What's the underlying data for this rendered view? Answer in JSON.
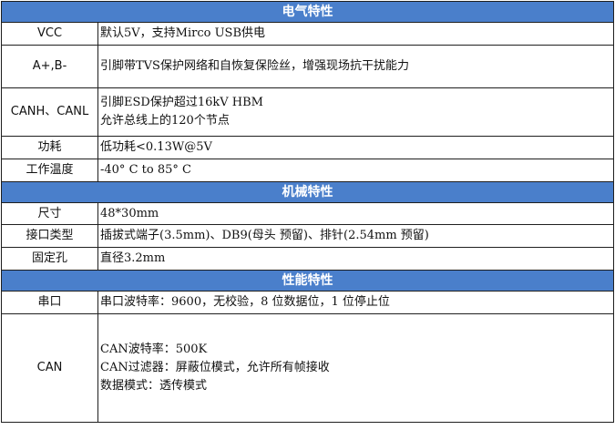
{
  "sections": {
    "electrical": {
      "title": "电气特性",
      "rows": [
        {
          "label": "VCC",
          "lines": [
            "默认5V，支持Mirco USB供电"
          ]
        },
        {
          "label": "A+,B-",
          "lines": [
            "引脚带TVS保护网络和自恢复保险丝，增强现场抗干扰能力"
          ]
        },
        {
          "label": "CANH、CANL",
          "lines": [
            "引脚ESD保护超过16kV HBM",
            "允许总线上的120个节点"
          ]
        },
        {
          "label": "功耗",
          "lines": [
            "低功耗<0.13W@5V"
          ]
        },
        {
          "label": "工作温度",
          "lines": [
            "-40° C to 85° C"
          ]
        }
      ]
    },
    "mechanical": {
      "title": "机械特性",
      "rows": [
        {
          "label": "尺寸",
          "lines": [
            "48*30mm"
          ]
        },
        {
          "label": "接口类型",
          "lines": [
            "插拔式端子(3.5mm)、DB9(母头 预留)、排针(2.54mm 预留)"
          ]
        },
        {
          "label": "固定孔",
          "lines": [
            "直径3.2mm"
          ]
        }
      ]
    },
    "performance": {
      "title": "性能特性",
      "rows": [
        {
          "label": "串口",
          "lines": [
            "串口波特率：9600，无校验，8 位数据位，1 位停止位"
          ]
        },
        {
          "label": "CAN",
          "lines": [
            "CAN波特率：500K",
            "CAN过滤器：屏蔽位模式，允许所有帧接收",
            "数据模式：透传模式"
          ]
        }
      ]
    }
  }
}
